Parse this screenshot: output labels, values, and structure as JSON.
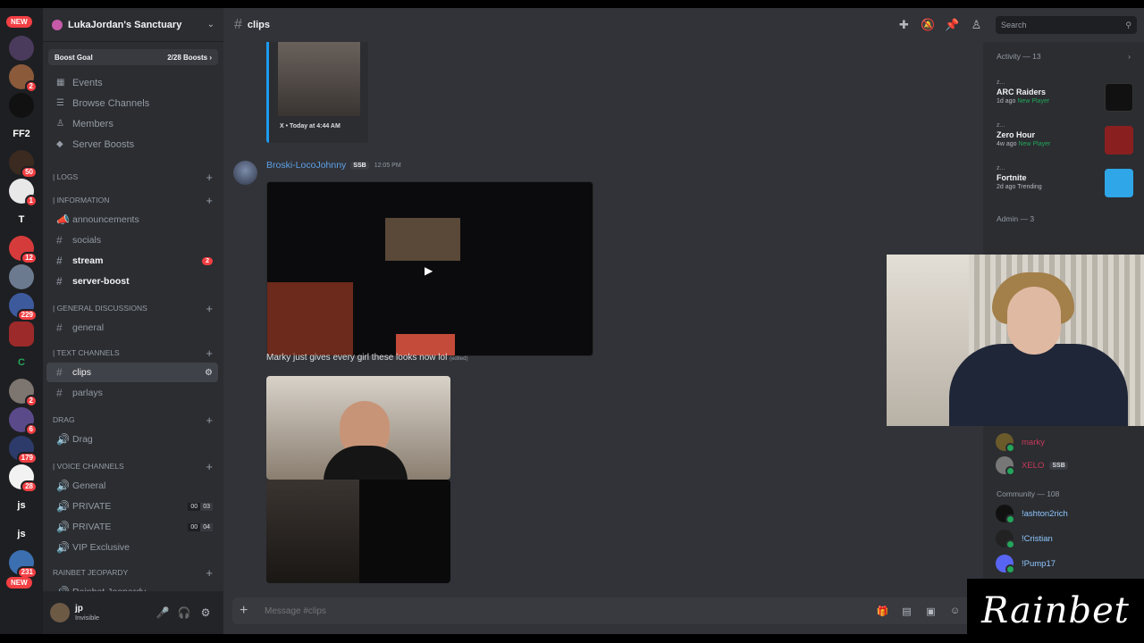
{
  "server": {
    "name": "LukaJordan's Sanctuary",
    "boost_goal_label": "Boost Goal",
    "boost_count": "2/28 Boosts"
  },
  "rail": {
    "new_top": "NEW",
    "new_bottom": "NEW",
    "items": [
      {
        "label": "",
        "badge": ""
      },
      {
        "label": "",
        "badge": "2"
      },
      {
        "label": "",
        "badge": ""
      },
      {
        "label": "FF2",
        "badge": ""
      },
      {
        "label": "",
        "badge": "50"
      },
      {
        "label": "",
        "badge": "1"
      },
      {
        "label": "T",
        "badge": ""
      },
      {
        "label": "",
        "badge": "12"
      },
      {
        "label": "",
        "badge": ""
      },
      {
        "label": "",
        "badge": "229"
      },
      {
        "label": "",
        "badge": ""
      },
      {
        "label": "C",
        "badge": ""
      },
      {
        "label": "",
        "badge": "2"
      },
      {
        "label": "",
        "badge": "6"
      },
      {
        "label": "",
        "badge": "179"
      },
      {
        "label": "",
        "badge": "28"
      },
      {
        "label": "js",
        "badge": ""
      },
      {
        "label": "js",
        "badge": ""
      },
      {
        "label": "",
        "badge": "231"
      }
    ]
  },
  "nav": {
    "events": "Events",
    "browse": "Browse Channels",
    "members": "Members",
    "boosts": "Server Boosts"
  },
  "categories": {
    "logs": "| LOGS",
    "information": "| INFORMATION",
    "general_discussions": "| GENERAL DISCUSSIONS",
    "text_channels": "| TEXT CHANNELS",
    "drag": "Drag",
    "voice_channels": "| Voice Channels",
    "rainbet": "Rainbet Jeopardy"
  },
  "channels": {
    "announcements": "announcements",
    "socials": "socials",
    "stream": "stream",
    "stream_badge": "2",
    "server_boost": "server-boost",
    "general": "general",
    "clips": "clips",
    "parlays": "parlays",
    "drag": "Drag",
    "voice_general": "General",
    "private1": "PRIVATE",
    "private1_a": "00",
    "private1_b": "03",
    "private2": "PRIVATE",
    "private2_a": "00",
    "private2_b": "04",
    "vip": "VIP Exclusive",
    "rainbet": "Rainbet Jeopardy"
  },
  "user": {
    "name": "jp",
    "status": "Invisible"
  },
  "topbar": {
    "channel": "clips",
    "search_placeholder": "Search"
  },
  "embed": {
    "source": "X • Today at 4:44 AM"
  },
  "message": {
    "author": "Broski-LocoJohnny",
    "tag": "SSB",
    "time": "12:05 PM",
    "text": "Marky just gives every girl these looks now lol",
    "edited": "(edited)"
  },
  "composer": {
    "placeholder": "Message #clips"
  },
  "activity": {
    "header": "Activity — 13",
    "items": [
      {
        "user": "z...",
        "game": "ARC Raiders",
        "ago": "1d ago",
        "meta": "New Player"
      },
      {
        "user": "z...",
        "game": "Zero Hour",
        "ago": "4w ago",
        "meta": "New Player"
      },
      {
        "user": "z...",
        "game": "Fortnite",
        "ago": "2d ago",
        "meta": "Trending"
      }
    ]
  },
  "members": {
    "admin_header": "Admin — 3",
    "marky": "marky",
    "xelo": "XELO",
    "xelo_tag": "SSB",
    "community_header": "Community — 108",
    "community": [
      "!ashton2rich",
      "!Cristian",
      "!Pump17"
    ]
  },
  "overlay": {
    "brand": "Rainbet"
  },
  "colors": {
    "accent": "#5865f2",
    "danger": "#f23f43",
    "online": "#23a55a",
    "author": "#5ea1e6"
  }
}
